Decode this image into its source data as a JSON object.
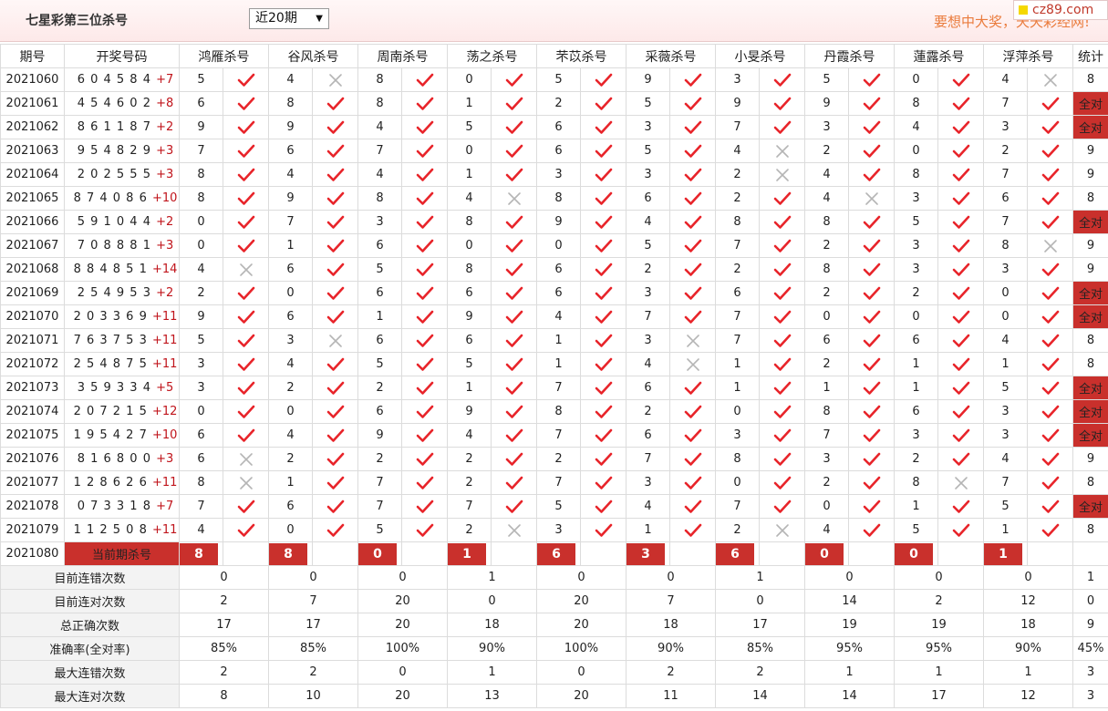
{
  "header": {
    "title": "七星彩第三位杀号",
    "select_value": "近20期",
    "slogan": "要想中大奖，天天彩经网!",
    "logo": "cz89.com"
  },
  "columns": {
    "period": "期号",
    "draw": "开奖号码",
    "experts": [
      "鸿雁杀号",
      "谷风杀号",
      "周南杀号",
      "荡之杀号",
      "芣苡杀号",
      "采薇杀号",
      "小旻杀号",
      "丹霞杀号",
      "蓮露杀号",
      "浮萍杀号"
    ],
    "total": "统计"
  },
  "rows": [
    {
      "period": "2021060",
      "draw": "6 0 4 5 8 4",
      "sum": "+7",
      "picks": [
        5,
        4,
        8,
        0,
        5,
        9,
        3,
        5,
        0,
        4
      ],
      "ok": [
        1,
        0,
        1,
        1,
        1,
        1,
        1,
        1,
        1,
        0
      ],
      "total": "8"
    },
    {
      "period": "2021061",
      "draw": "4 5 4 6 0 2",
      "sum": "+8",
      "picks": [
        6,
        8,
        8,
        1,
        2,
        5,
        9,
        9,
        8,
        7
      ],
      "ok": [
        1,
        1,
        1,
        1,
        1,
        1,
        1,
        1,
        1,
        1
      ],
      "total": "全对"
    },
    {
      "period": "2021062",
      "draw": "8 6 1 1 8 7",
      "sum": "+2",
      "picks": [
        9,
        9,
        4,
        5,
        6,
        3,
        7,
        3,
        4,
        3
      ],
      "ok": [
        1,
        1,
        1,
        1,
        1,
        1,
        1,
        1,
        1,
        1
      ],
      "total": "全对"
    },
    {
      "period": "2021063",
      "draw": "9 5 4 8 2 9",
      "sum": "+3",
      "picks": [
        7,
        6,
        7,
        0,
        6,
        5,
        4,
        2,
        0,
        2
      ],
      "ok": [
        1,
        1,
        1,
        1,
        1,
        1,
        0,
        1,
        1,
        1
      ],
      "total": "9"
    },
    {
      "period": "2021064",
      "draw": "2 0 2 5 5 5",
      "sum": "+3",
      "picks": [
        8,
        4,
        4,
        1,
        3,
        3,
        2,
        4,
        8,
        7
      ],
      "ok": [
        1,
        1,
        1,
        1,
        1,
        1,
        0,
        1,
        1,
        1
      ],
      "total": "9"
    },
    {
      "period": "2021065",
      "draw": "8 7 4 0 8 6",
      "sum": "+10",
      "picks": [
        8,
        9,
        8,
        4,
        8,
        6,
        2,
        4,
        3,
        6
      ],
      "ok": [
        1,
        1,
        1,
        0,
        1,
        1,
        1,
        0,
        1,
        1
      ],
      "total": "8"
    },
    {
      "period": "2021066",
      "draw": "5 9 1 0 4 4",
      "sum": "+2",
      "picks": [
        0,
        7,
        3,
        8,
        9,
        4,
        8,
        8,
        5,
        7
      ],
      "ok": [
        1,
        1,
        1,
        1,
        1,
        1,
        1,
        1,
        1,
        1
      ],
      "total": "全对"
    },
    {
      "period": "2021067",
      "draw": "7 0 8 8 8 1",
      "sum": "+3",
      "picks": [
        0,
        1,
        6,
        0,
        0,
        5,
        7,
        2,
        3,
        8
      ],
      "ok": [
        1,
        1,
        1,
        1,
        1,
        1,
        1,
        1,
        1,
        0
      ],
      "total": "9"
    },
    {
      "period": "2021068",
      "draw": "8 8 4 8 5 1",
      "sum": "+14",
      "picks": [
        4,
        6,
        5,
        8,
        6,
        2,
        2,
        8,
        3,
        3
      ],
      "ok": [
        0,
        1,
        1,
        1,
        1,
        1,
        1,
        1,
        1,
        1
      ],
      "total": "9"
    },
    {
      "period": "2021069",
      "draw": "2 5 4 9 5 3",
      "sum": "+2",
      "picks": [
        2,
        0,
        6,
        6,
        6,
        3,
        6,
        2,
        2,
        0
      ],
      "ok": [
        1,
        1,
        1,
        1,
        1,
        1,
        1,
        1,
        1,
        1
      ],
      "total": "全对"
    },
    {
      "period": "2021070",
      "draw": "2 0 3 3 6 9",
      "sum": "+11",
      "picks": [
        9,
        6,
        1,
        9,
        4,
        7,
        7,
        0,
        0,
        0
      ],
      "ok": [
        1,
        1,
        1,
        1,
        1,
        1,
        1,
        1,
        1,
        1
      ],
      "total": "全对"
    },
    {
      "period": "2021071",
      "draw": "7 6 3 7 5 3",
      "sum": "+11",
      "picks": [
        5,
        3,
        6,
        6,
        1,
        3,
        7,
        6,
        6,
        4
      ],
      "ok": [
        1,
        0,
        1,
        1,
        1,
        0,
        1,
        1,
        1,
        1
      ],
      "total": "8"
    },
    {
      "period": "2021072",
      "draw": "2 5 4 8 7 5",
      "sum": "+11",
      "picks": [
        3,
        4,
        5,
        5,
        1,
        4,
        1,
        2,
        1,
        1
      ],
      "ok": [
        1,
        1,
        1,
        1,
        1,
        0,
        1,
        1,
        1,
        1
      ],
      "total": "8"
    },
    {
      "period": "2021073",
      "draw": "3 5 9 3 3 4",
      "sum": "+5",
      "picks": [
        3,
        2,
        2,
        1,
        7,
        6,
        1,
        1,
        1,
        5
      ],
      "ok": [
        1,
        1,
        1,
        1,
        1,
        1,
        1,
        1,
        1,
        1
      ],
      "total": "全对"
    },
    {
      "period": "2021074",
      "draw": "2 0 7 2 1 5",
      "sum": "+12",
      "picks": [
        0,
        0,
        6,
        9,
        8,
        2,
        0,
        8,
        6,
        3
      ],
      "ok": [
        1,
        1,
        1,
        1,
        1,
        1,
        1,
        1,
        1,
        1
      ],
      "total": "全对"
    },
    {
      "period": "2021075",
      "draw": "1 9 5 4 2 7",
      "sum": "+10",
      "picks": [
        6,
        4,
        9,
        4,
        7,
        6,
        3,
        7,
        3,
        3
      ],
      "ok": [
        1,
        1,
        1,
        1,
        1,
        1,
        1,
        1,
        1,
        1
      ],
      "total": "全对"
    },
    {
      "period": "2021076",
      "draw": "8 1 6 8 0 0",
      "sum": "+3",
      "picks": [
        6,
        2,
        2,
        2,
        2,
        7,
        8,
        3,
        2,
        4
      ],
      "ok": [
        0,
        1,
        1,
        1,
        1,
        1,
        1,
        1,
        1,
        1
      ],
      "total": "9"
    },
    {
      "period": "2021077",
      "draw": "1 2 8 6 2 6",
      "sum": "+11",
      "picks": [
        8,
        1,
        7,
        2,
        7,
        3,
        0,
        2,
        8,
        7
      ],
      "ok": [
        0,
        1,
        1,
        1,
        1,
        1,
        1,
        1,
        0,
        1
      ],
      "total": "8"
    },
    {
      "period": "2021078",
      "draw": "0 7 3 3 1 8",
      "sum": "+7",
      "picks": [
        7,
        6,
        7,
        7,
        5,
        4,
        7,
        0,
        1,
        5
      ],
      "ok": [
        1,
        1,
        1,
        1,
        1,
        1,
        1,
        1,
        1,
        1
      ],
      "total": "全对"
    },
    {
      "period": "2021079",
      "draw": "1 1 2 5 0 8",
      "sum": "+11",
      "picks": [
        4,
        0,
        5,
        2,
        3,
        1,
        2,
        4,
        5,
        1
      ],
      "ok": [
        1,
        1,
        1,
        0,
        1,
        1,
        0,
        1,
        1,
        1
      ],
      "total": "8"
    }
  ],
  "current": {
    "period": "2021080",
    "label": "当前期杀号",
    "picks": [
      "8",
      "8",
      "0",
      "1",
      "6",
      "3",
      "6",
      "0",
      "0",
      "1"
    ]
  },
  "stats": [
    {
      "label": "目前连错次数",
      "values": [
        "0",
        "0",
        "0",
        "1",
        "0",
        "0",
        "1",
        "0",
        "0",
        "0"
      ],
      "total": "1",
      "kind": "val"
    },
    {
      "label": "目前连对次数",
      "values": [
        "2",
        "7",
        "20",
        "0",
        "20",
        "7",
        "0",
        "14",
        "2",
        "12"
      ],
      "total": "0",
      "kind": "val"
    },
    {
      "label": "总正确次数",
      "values": [
        "17",
        "17",
        "20",
        "18",
        "20",
        "18",
        "17",
        "19",
        "19",
        "18"
      ],
      "total": "9",
      "kind": "val"
    },
    {
      "label": "准确率(全对率)",
      "values": [
        "85%",
        "85%",
        "100%",
        "90%",
        "100%",
        "90%",
        "85%",
        "95%",
        "95%",
        "90%"
      ],
      "total": "45%",
      "kind": "rate"
    },
    {
      "label": "最大连错次数",
      "values": [
        "2",
        "2",
        "0",
        "1",
        "0",
        "2",
        "2",
        "1",
        "1",
        "1"
      ],
      "total": "3",
      "kind": "val"
    },
    {
      "label": "最大连对次数",
      "values": [
        "8",
        "10",
        "20",
        "13",
        "20",
        "11",
        "14",
        "14",
        "17",
        "12"
      ],
      "total": "3",
      "kind": "val"
    }
  ],
  "colors": {
    "accent": "#c9302c",
    "check": "#e8242a",
    "cross": "#b5b5b5",
    "stat_blue": "#1a3aa8",
    "rate_red": "#d01a1a"
  }
}
